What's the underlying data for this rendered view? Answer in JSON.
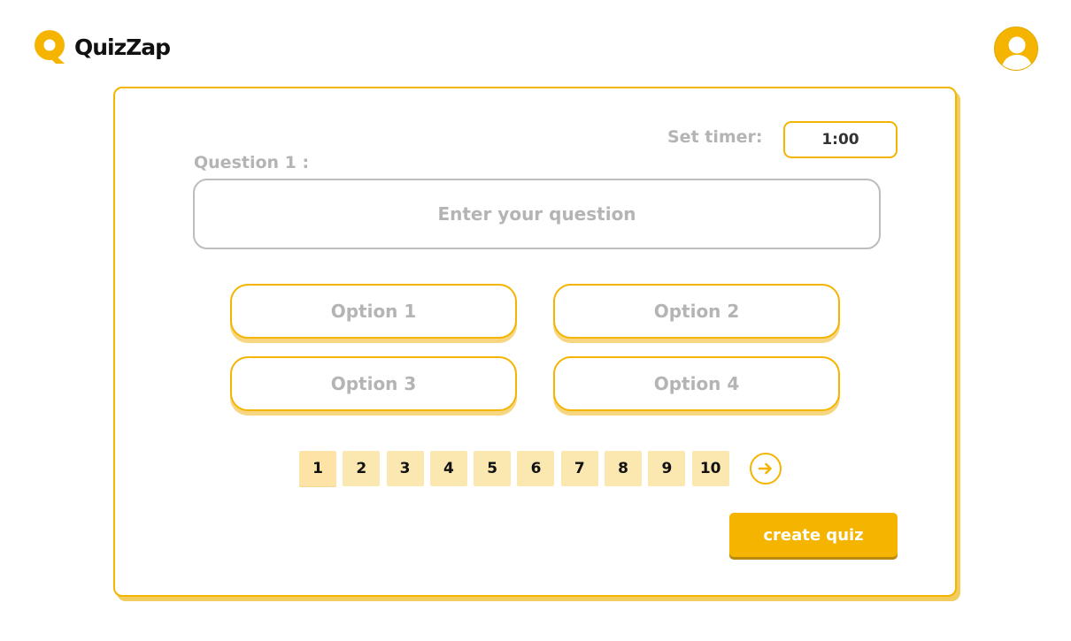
{
  "brand": {
    "name": "QuizZap",
    "logo_icon": "q-logo-icon",
    "accent_color": "#f4b400"
  },
  "user": {
    "avatar_icon": "user-avatar-icon"
  },
  "timer": {
    "label": "Set timer:",
    "value": "1:00"
  },
  "question": {
    "label": "Question 1 :",
    "placeholder": "Enter your question"
  },
  "options": [
    {
      "placeholder": "Option 1"
    },
    {
      "placeholder": "Option 2"
    },
    {
      "placeholder": "Option 3"
    },
    {
      "placeholder": "Option 4"
    }
  ],
  "pagination": {
    "pages": [
      "1",
      "2",
      "3",
      "4",
      "5",
      "6",
      "7",
      "8",
      "9",
      "10"
    ],
    "current": "1",
    "next_icon": "arrow-right-circle-icon"
  },
  "actions": {
    "create_label": "create quiz"
  }
}
